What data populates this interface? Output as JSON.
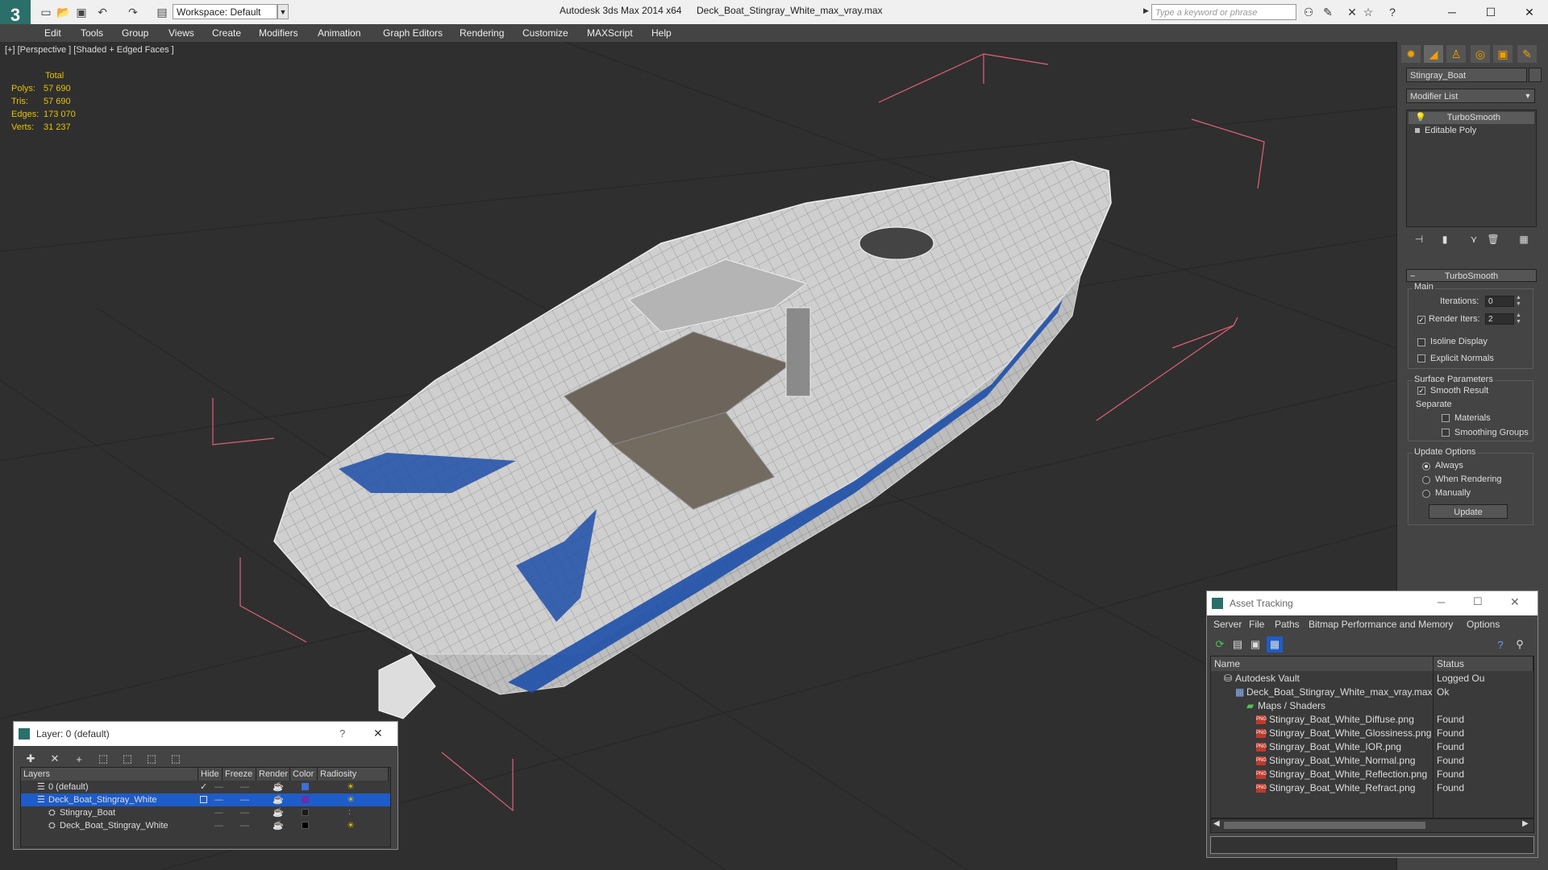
{
  "titlebar": {
    "app_title": "Autodesk 3ds Max  2014 x64",
    "document": "Deck_Boat_Stingray_White_max_vray.max",
    "workspace": "Workspace: Default",
    "search_placeholder": "Type a keyword or phrase"
  },
  "menu": [
    "Edit",
    "Tools",
    "Group",
    "Views",
    "Create",
    "Modifiers",
    "Animation",
    "Graph Editors",
    "Rendering",
    "Customize",
    "MAXScript",
    "Help"
  ],
  "viewport": {
    "label": "[+] [Perspective ] [Shaded + Edged Faces ]",
    "stats": {
      "header": "Total",
      "rows": [
        {
          "label": "Polys:",
          "value": "57 690"
        },
        {
          "label": "Tris:",
          "value": "57 690"
        },
        {
          "label": "Edges:",
          "value": "173 070"
        },
        {
          "label": "Verts:",
          "value": "31 237"
        }
      ]
    }
  },
  "command_panel": {
    "object_name": "Stingray_Boat",
    "modifier_list": "Modifier List",
    "stack": [
      "TurboSmooth",
      "Editable Poly"
    ],
    "rollout_title": "TurboSmooth",
    "main_group": "Main",
    "iterations_label": "Iterations:",
    "iterations_value": "0",
    "render_iters_label": "Render Iters:",
    "render_iters_value": "2",
    "isoline_label": "Isoline Display",
    "explicit_normals_label": "Explicit Normals",
    "surface_group": "Surface Parameters",
    "smooth_result_label": "Smooth Result",
    "separate_label": "Separate",
    "materials_label": "Materials",
    "smoothing_groups_label": "Smoothing Groups",
    "update_group": "Update Options",
    "always_label": "Always",
    "when_rendering_label": "When Rendering",
    "manually_label": "Manually",
    "update_button": "Update"
  },
  "layer_dialog": {
    "title": "Layer: 0 (default)",
    "help": "?",
    "columns": [
      "Layers",
      "Hide",
      "Freeze",
      "Render",
      "Color",
      "Radiosity"
    ],
    "rows": [
      {
        "name": "0 (default)",
        "indent": 1,
        "active": true,
        "selected": false,
        "color": "#3d6fd6"
      },
      {
        "name": "Deck_Boat_Stingray_White",
        "indent": 1,
        "active": false,
        "selected": true,
        "color": "#6b2fa8"
      },
      {
        "name": "Stingray_Boat",
        "indent": 2,
        "active": false,
        "selected": false,
        "color": "#1a1a1a"
      },
      {
        "name": "Deck_Boat_Stingray_White",
        "indent": 2,
        "active": false,
        "selected": false,
        "color": "#000000"
      }
    ]
  },
  "asset_dialog": {
    "title": "Asset Tracking",
    "menu": [
      "Server",
      "File",
      "Paths",
      "Bitmap Performance and Memory",
      "Options"
    ],
    "columns": [
      "Name",
      "Status"
    ],
    "rows": [
      {
        "name": "Autodesk Vault",
        "status": "Logged Ou",
        "indent": 1,
        "icon": "vault-icon"
      },
      {
        "name": "Deck_Boat_Stingray_White_max_vray.max",
        "status": "Ok",
        "indent": 2,
        "icon": "max-file-icon"
      },
      {
        "name": "Maps / Shaders",
        "status": "",
        "indent": 3,
        "icon": "folder-icon"
      },
      {
        "name": "Stingray_Boat_White_Diffuse.png",
        "status": "Found",
        "indent": 4,
        "icon": "png-icon"
      },
      {
        "name": "Stingray_Boat_White_Glossiness.png",
        "status": "Found",
        "indent": 4,
        "icon": "png-icon"
      },
      {
        "name": "Stingray_Boat_White_IOR.png",
        "status": "Found",
        "indent": 4,
        "icon": "png-icon"
      },
      {
        "name": "Stingray_Boat_White_Normal.png",
        "status": "Found",
        "indent": 4,
        "icon": "png-icon"
      },
      {
        "name": "Stingray_Boat_White_Reflection.png",
        "status": "Found",
        "indent": 4,
        "icon": "png-icon"
      },
      {
        "name": "Stingray_Boat_White_Refract.png",
        "status": "Found",
        "indent": 4,
        "icon": "png-icon"
      }
    ]
  },
  "colors": {
    "accent": "#2a6f6a",
    "selection": "#1e5cc8",
    "stats": "#e6c200",
    "gizmo": "#e0607a"
  }
}
